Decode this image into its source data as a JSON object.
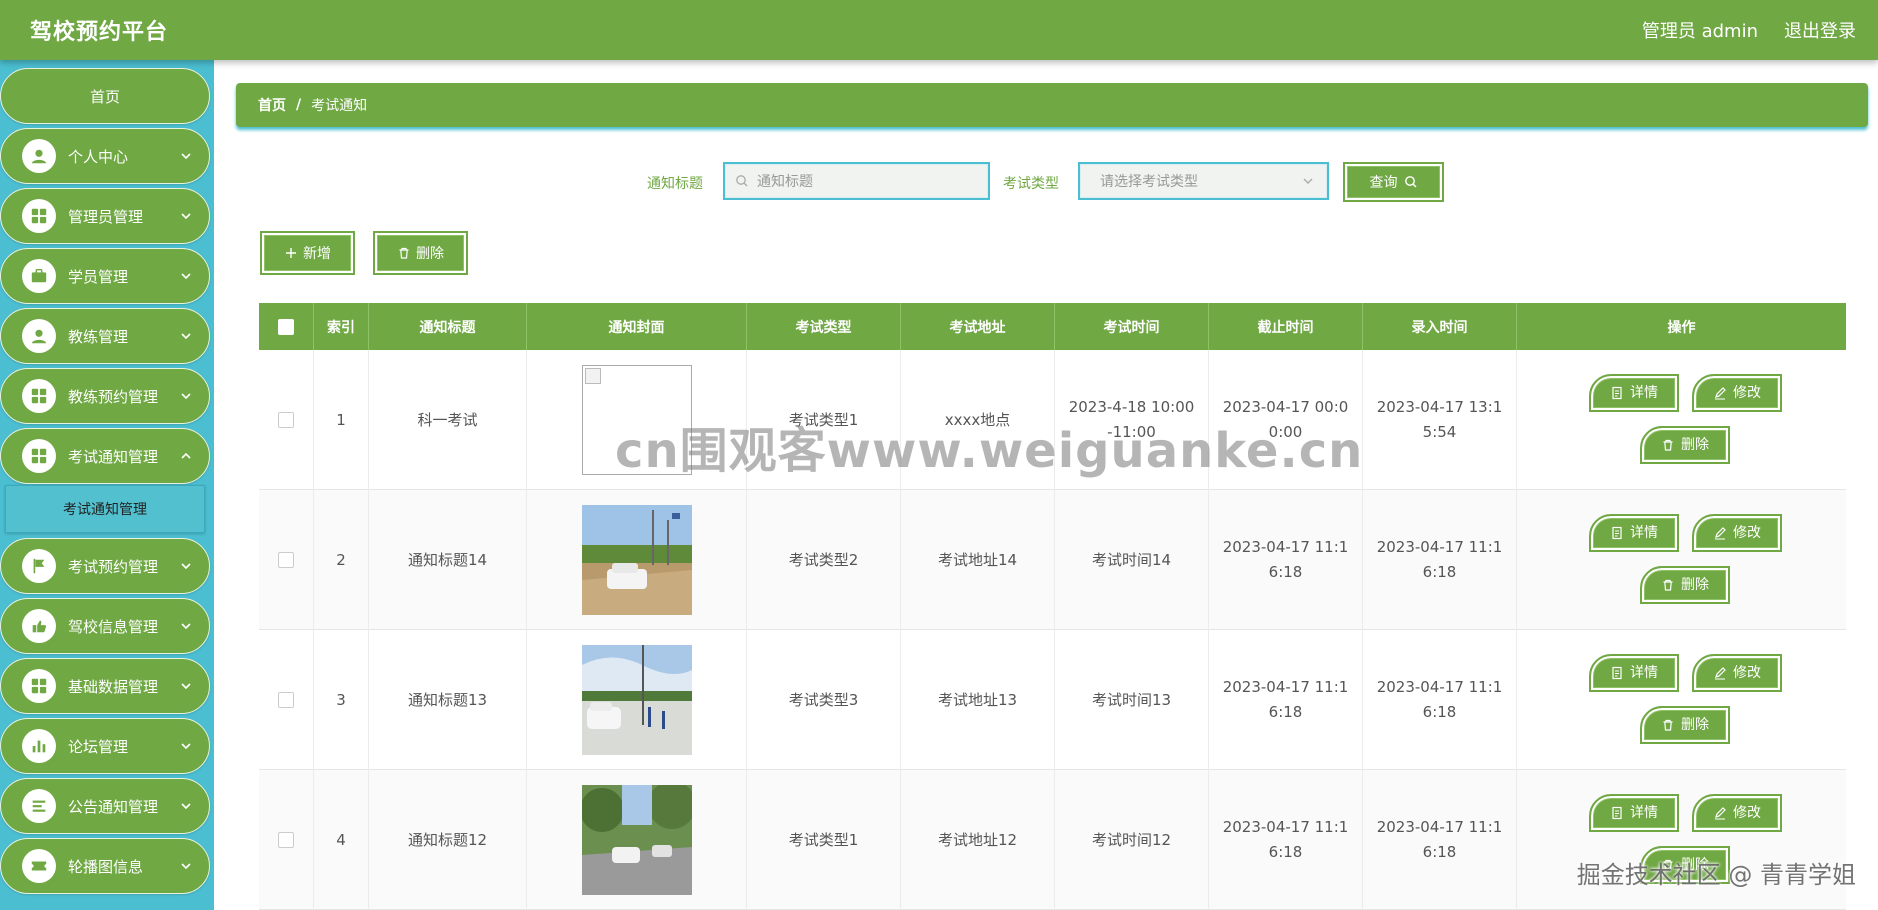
{
  "header": {
    "brand": "驾校预约平台",
    "user": "管理员 admin",
    "logout": "退出登录"
  },
  "sidebar": {
    "home": "首页",
    "items": [
      {
        "label": "个人中心",
        "icon": "user-icon"
      },
      {
        "label": "管理员管理",
        "icon": "grid-icon"
      },
      {
        "label": "学员管理",
        "icon": "briefcase-icon"
      },
      {
        "label": "教练管理",
        "icon": "user-icon"
      },
      {
        "label": "教练预约管理",
        "icon": "grid-icon"
      },
      {
        "label": "考试通知管理",
        "icon": "grid-icon"
      },
      {
        "label": "考试预约管理",
        "icon": "flag-icon"
      },
      {
        "label": "驾校信息管理",
        "icon": "hand-icon"
      },
      {
        "label": "基础数据管理",
        "icon": "grid-icon"
      },
      {
        "label": "论坛管理",
        "icon": "bar-chart-icon"
      },
      {
        "label": "公告通知管理",
        "icon": "list-icon"
      },
      {
        "label": "轮播图信息",
        "icon": "ticket-icon"
      }
    ],
    "submenu": "考试通知管理"
  },
  "breadcrumb": {
    "home": "首页",
    "sep": "/",
    "current": "考试通知"
  },
  "search": {
    "title_label": "通知标题",
    "title_placeholder": "通知标题",
    "type_label": "考试类型",
    "type_placeholder": "请选择考试类型",
    "query": "查询"
  },
  "actions": {
    "add": "新增",
    "delete": "删除"
  },
  "table": {
    "headers": [
      "索引",
      "通知标题",
      "通知封面",
      "考试类型",
      "考试地址",
      "考试时间",
      "截止时间",
      "录入时间",
      "操作"
    ],
    "rows": [
      {
        "index": "1",
        "title": "科一考试",
        "cover": "broken",
        "type": "考试类型1",
        "address": "xxxx地点",
        "exam_time": "2023-4-18 10:00-11:00",
        "deadline": "2023-04-17 00:00:00",
        "created": "2023-04-17 13:15:54"
      },
      {
        "index": "2",
        "title": "通知标题14",
        "cover": "photo",
        "type": "考试类型2",
        "address": "考试地址14",
        "exam_time": "考试时间14",
        "deadline": "2023-04-17 11:16:18",
        "created": "2023-04-17 11:16:18"
      },
      {
        "index": "3",
        "title": "通知标题13",
        "cover": "photo",
        "type": "考试类型3",
        "address": "考试地址13",
        "exam_time": "考试时间13",
        "deadline": "2023-04-17 11:16:18",
        "created": "2023-04-17 11:16:18"
      },
      {
        "index": "4",
        "title": "通知标题12",
        "cover": "photo",
        "type": "考试类型1",
        "address": "考试地址12",
        "exam_time": "考试时间12",
        "deadline": "2023-04-17 11:16:18",
        "created": "2023-04-17 11:16:18"
      }
    ],
    "ops": {
      "detail": "详情",
      "edit": "修改",
      "delete": "删除"
    }
  },
  "watermarks": {
    "center": "cn围观客www.weiguanke.cn",
    "corner": "掘金技术社区 @ 青青学姐"
  },
  "colors": {
    "primary": "#70a844",
    "sidebar_bg": "#4bbfd1",
    "border_accent": "#4bbfd1"
  }
}
